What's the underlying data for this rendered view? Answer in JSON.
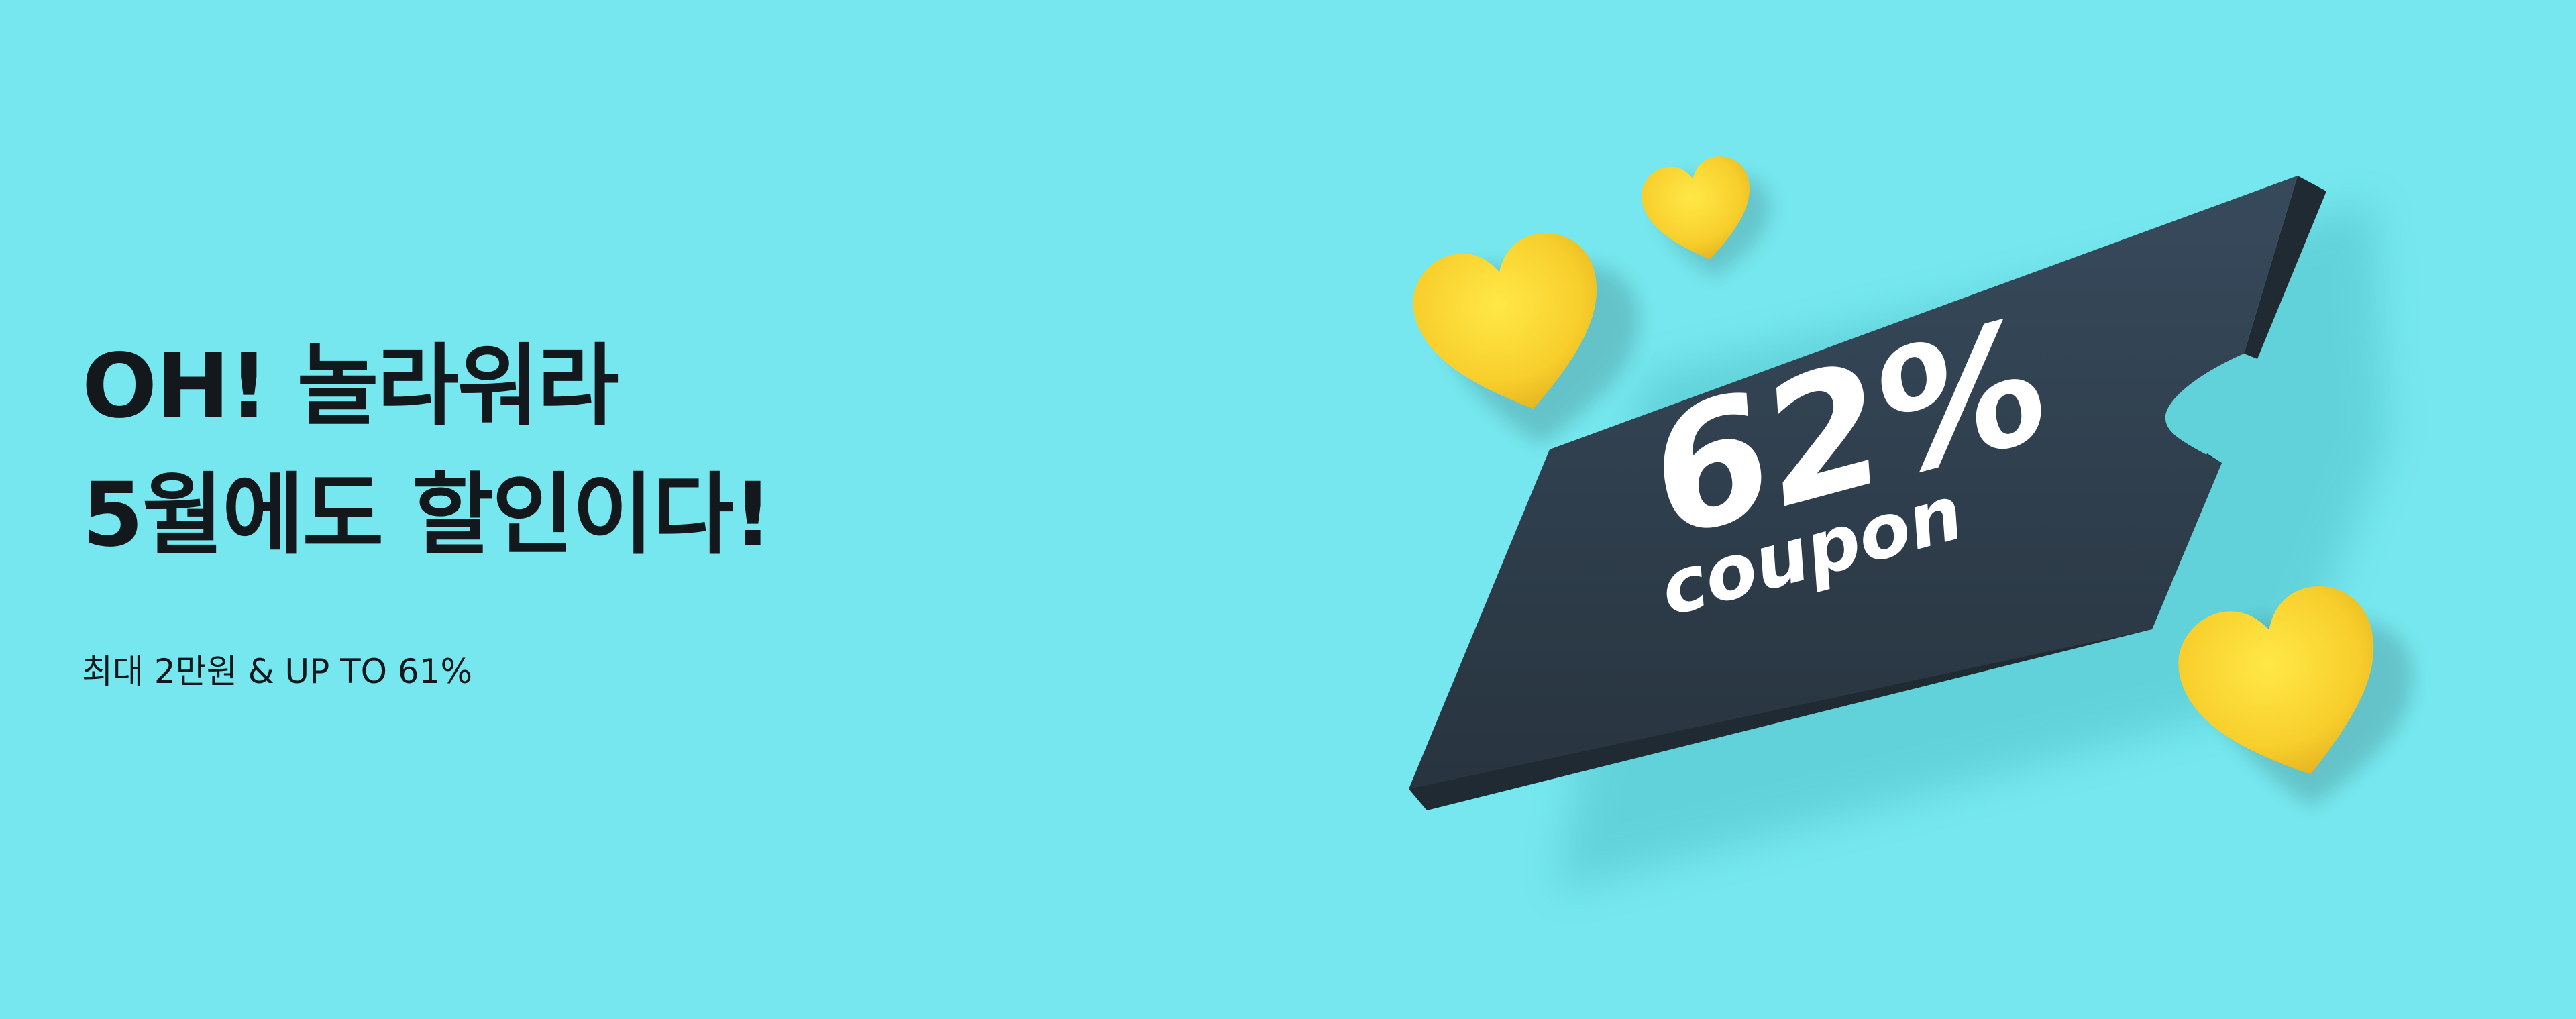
{
  "banner": {
    "headline_line1": "OH! 놀라워라",
    "headline_line2": "5월에도 할인이다!",
    "subcopy": "최대 2만원 & UP TO 61%",
    "background_color": "#76e7ee"
  },
  "coupon": {
    "percent": "62%",
    "label": "coupon",
    "color": "#2e3c4a",
    "text_color": "#ffffff"
  },
  "decorations": {
    "heart_icon": "heart-icon",
    "heart_color": "#f6cc2a"
  }
}
